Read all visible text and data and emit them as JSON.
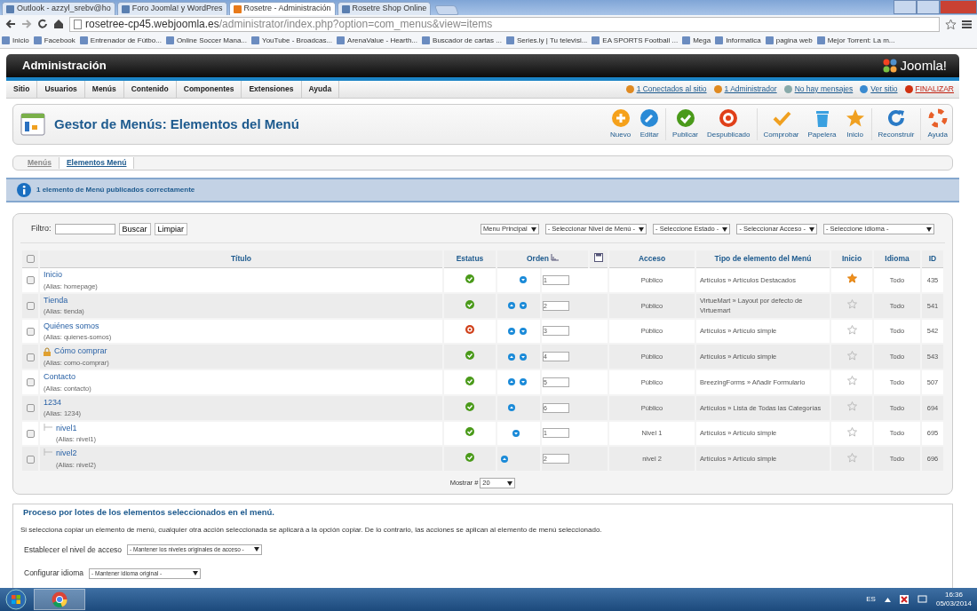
{
  "browser": {
    "tabs": [
      {
        "title": "Outlook - azzyl_srebv@ho",
        "selected": false
      },
      {
        "title": "Foro Joomla! y WordPres",
        "selected": false
      },
      {
        "title": "Rosetre - Administración",
        "selected": true
      },
      {
        "title": "Rosetre Shop Online",
        "selected": false
      }
    ],
    "address": {
      "host": "rosetree-cp45.webjoomla.es",
      "path": "/administrator/index.php?option=com_menus&view=items"
    },
    "bookmarks": [
      "Inicio",
      "Facebook",
      "Entrenador de Fútbo...",
      "Online Soccer Mana...",
      "YouTube - Broadcas...",
      "ArenaValue - Hearth...",
      "Buscador de cartas ...",
      "Series.ly | Tu televisi...",
      "EA SPORTS Football ...",
      "Mega",
      "Informatica",
      "pagina web",
      "Mejor Torrent: La m..."
    ]
  },
  "header": {
    "title": "Administración",
    "logo": "Joomla!"
  },
  "menu": {
    "items": [
      "Sitio",
      "Usuarios",
      "Menús",
      "Contenido",
      "Componentes",
      "Extensiones",
      "Ayuda"
    ],
    "status": [
      {
        "label": "1 Conectados al sitio",
        "kind": "users"
      },
      {
        "label": "1 Administrador",
        "kind": "admin"
      },
      {
        "label": "No hay mensajes",
        "kind": "messages"
      },
      {
        "label": "Ver sitio",
        "kind": "site"
      },
      {
        "label": "FINALIZAR",
        "kind": "logout"
      }
    ]
  },
  "toolbar": {
    "title": "Gestor de Menús: Elementos del Menú",
    "buttons": [
      {
        "label": "Nuevo",
        "kind": "new",
        "separator_before": false
      },
      {
        "label": "Editar",
        "kind": "edit",
        "separator_before": false
      },
      {
        "label": "Publicar",
        "kind": "publish",
        "separator_before": true
      },
      {
        "label": "Despublicado",
        "kind": "unpublish",
        "separator_before": false
      },
      {
        "label": "Comprobar",
        "kind": "checkin",
        "separator_before": true
      },
      {
        "label": "Papelera",
        "kind": "trash",
        "separator_before": false
      },
      {
        "label": "Inicio",
        "kind": "home",
        "separator_before": false
      },
      {
        "label": "Reconstruir",
        "kind": "rebuild",
        "separator_before": true
      },
      {
        "label": "Ayuda",
        "kind": "help",
        "separator_before": true
      }
    ]
  },
  "submenu": [
    {
      "label": "Menús",
      "selected": false
    },
    {
      "label": "Elementos Menú",
      "selected": true
    }
  ],
  "message": "1 elemento de Menú publicados correctamente",
  "filter": {
    "label": "Filtro:",
    "buttons": [
      "Buscar",
      "Limpiar"
    ],
    "selects": [
      "Menu Principal",
      "- Seleccionar Nivel de Menú -",
      "- Seleccione Estado -",
      "- Seleccionar Acceso -",
      "- Seleccione Idioma -"
    ]
  },
  "table": {
    "select_all": {
      "checked": false
    },
    "columns": [
      "Título",
      "Estatus",
      "Orden",
      "Acceso",
      "Tipo de elemento del Menú",
      "Inicio",
      "Idioma",
      "ID"
    ],
    "rows": [
      {
        "title": "Inicio",
        "alias": "(Alias: homepage)",
        "checked": false,
        "checked_out": false,
        "published": true,
        "up": false,
        "down": true,
        "order": "1",
        "access": "Público",
        "type": "Artículos » Artículos Destacados",
        "home": true,
        "language": "Todo",
        "id": "435"
      },
      {
        "title": "Tienda",
        "alias": "(Alias: tienda)",
        "checked": false,
        "checked_out": false,
        "published": true,
        "up": true,
        "down": true,
        "order": "2",
        "access": "Público",
        "type": "VirtueMart » Layout por defecto de Virtuemart",
        "home": false,
        "language": "Todo",
        "id": "541"
      },
      {
        "title": "Quiénes somos",
        "alias": "(Alias: quienes-somos)",
        "checked": false,
        "checked_out": false,
        "published": false,
        "up": true,
        "down": true,
        "order": "3",
        "access": "Público",
        "type": "Artículos » Artículo simple",
        "home": false,
        "language": "Todo",
        "id": "542"
      },
      {
        "title": "Cómo comprar",
        "alias": "(Alias: como-comprar)",
        "checked": false,
        "checked_out": true,
        "published": true,
        "up": true,
        "down": true,
        "order": "4",
        "access": "Público",
        "type": "Artículos » Artículo simple",
        "home": false,
        "language": "Todo",
        "id": "543"
      },
      {
        "title": "Contacto",
        "alias": "(Alias: contacto)",
        "checked": false,
        "checked_out": false,
        "published": true,
        "up": true,
        "down": true,
        "order": "5",
        "access": "Público",
        "type": "BreezingForms » Añadir Formulario",
        "home": false,
        "language": "Todo",
        "id": "507"
      },
      {
        "title": "1234",
        "alias": "(Alias: 1234)",
        "checked": false,
        "checked_out": false,
        "published": true,
        "up": true,
        "down": false,
        "order": "6",
        "access": "Público",
        "type": "Artículos » Lista de Todas las Categorías",
        "home": false,
        "language": "Todo",
        "id": "694",
        "children": [
          {
            "title": "nivel1",
            "alias": "(Alias: nivel1)",
            "checked": false,
            "checked_out": false,
            "published": true,
            "up": false,
            "down": true,
            "order": "1",
            "access": "Nivel 1",
            "type": "Artículos » Artículo simple",
            "home": false,
            "language": "Todo",
            "id": "695"
          },
          {
            "title": "nivel2",
            "alias": "(Alias: nivel2)",
            "checked": false,
            "checked_out": false,
            "published": true,
            "up": true,
            "down": false,
            "order": "2",
            "access": "nivel 2",
            "type": "Artículos » Artículo simple",
            "home": false,
            "language": "Todo",
            "id": "696"
          }
        ]
      }
    ]
  },
  "pagination": {
    "label": "Mostrar #",
    "value": "20"
  },
  "batch": {
    "legend": "Proceso por lotes de los elementos seleccionados en el menú.",
    "note": "Si selecciona copiar un elemento de menú, cualquier otra acción seleccionada se aplicará a la opción copiar. De lo contrario, las acciones se aplican al elemento de menú seleccionado.",
    "fields": [
      {
        "label": "Establecer el nivel de acceso",
        "value": "- Mantener los niveles originales de acceso -"
      },
      {
        "label": "Configurar idioma",
        "value": "- Mantener idioma original -"
      }
    ]
  },
  "taskbar": {
    "language": "ES",
    "time": "16:36",
    "date": "05/03/2014"
  }
}
